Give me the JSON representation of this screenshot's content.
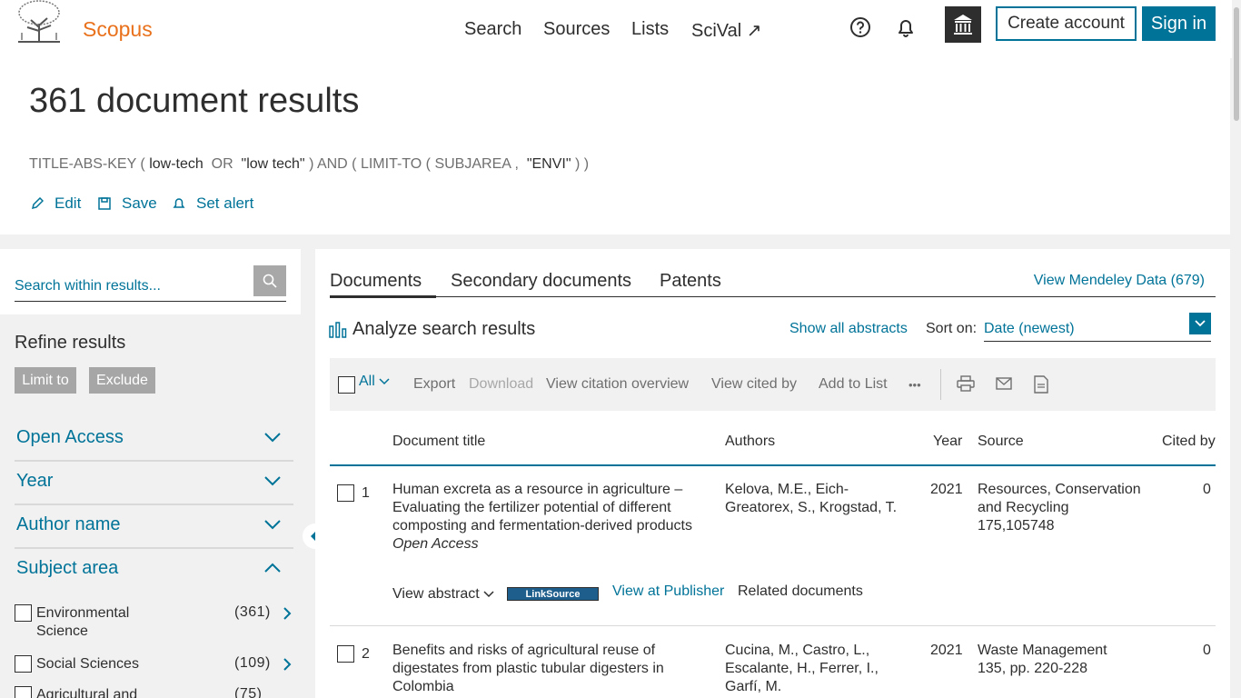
{
  "header": {
    "brand": "Scopus",
    "nav": [
      "Search",
      "Sources",
      "Lists",
      "SciVal ↗"
    ],
    "icons": [
      "help-icon",
      "bell-icon",
      "institution-icon"
    ],
    "create_account": "Create account",
    "sign_in": "Sign in"
  },
  "results": {
    "title": "361 document results",
    "query": {
      "p1": "TITLE-ABS-KEY (",
      "t1": "low-tech",
      "p2": "OR",
      "t2": "\"low tech\"",
      "p3": ")  AND  ( LIMIT-TO ( SUBJAREA ,",
      "t3": "\"ENVI\"",
      "p4": ") )"
    },
    "actions": {
      "edit": "Edit",
      "save": "Save",
      "alert": "Set alert"
    }
  },
  "sidebar": {
    "search_placeholder": "Search within results...",
    "refine_title": "Refine results",
    "limit_to": "Limit to",
    "exclude": "Exclude",
    "facets": [
      "Open Access",
      "Year",
      "Author name",
      "Subject area"
    ],
    "subjects": [
      {
        "label": "Environmental Science",
        "count": "(361)"
      },
      {
        "label": "Social Sciences",
        "count": "(109)"
      },
      {
        "label": "Agricultural and",
        "count": "(75)"
      }
    ]
  },
  "main": {
    "tabs": [
      "Documents",
      "Secondary documents",
      "Patents"
    ],
    "mendeley": "View Mendeley Data (679)",
    "analyze": "Analyze search results",
    "show_abstracts": "Show all abstracts",
    "sort_label": "Sort on:",
    "sort_value": "Date (newest)",
    "toolbar": {
      "all": "All",
      "export": "Export",
      "download": "Download",
      "citation_overview": "View citation overview",
      "cited_by": "View cited by",
      "add_to_list": "Add to List",
      "more": "•••"
    },
    "columns": {
      "title": "Document title",
      "authors": "Authors",
      "year": "Year",
      "source": "Source",
      "cited": "Cited by"
    },
    "rows": [
      {
        "num": "1",
        "title_l1": "Human excreta as a resource in agriculture –",
        "title_l2": "Evaluating the fertilizer potential of different",
        "title_l3": "composting and fermentation-derived products",
        "access": "Open Access",
        "authors_l1": "Kelova, M.E., Eich-",
        "authors_l2": "Greatorex, S., Krogstad, T.",
        "year": "2021",
        "source_l1": "Resources, Conservation",
        "source_l2": "and Recycling",
        "source_l3": "175,105748",
        "cited": "0",
        "view_abstract": "View abstract",
        "linksource": "LinkSource",
        "view_publisher": "View at Publisher",
        "related": "Related documents"
      },
      {
        "num": "2",
        "title_l1": "Benefits and risks of agricultural reuse of",
        "title_l2": "digestates from plastic tubular digesters in",
        "title_l3": "Colombia",
        "authors_l1": "Cucina, M., Castro, L.,",
        "authors_l2": "Escalante, H., Ferrer, I.,",
        "authors_l3": "Garfí, M.",
        "year": "2021",
        "source_l1": "Waste Management",
        "source_l2": "135, pp. 220-228",
        "cited": "0"
      }
    ]
  }
}
